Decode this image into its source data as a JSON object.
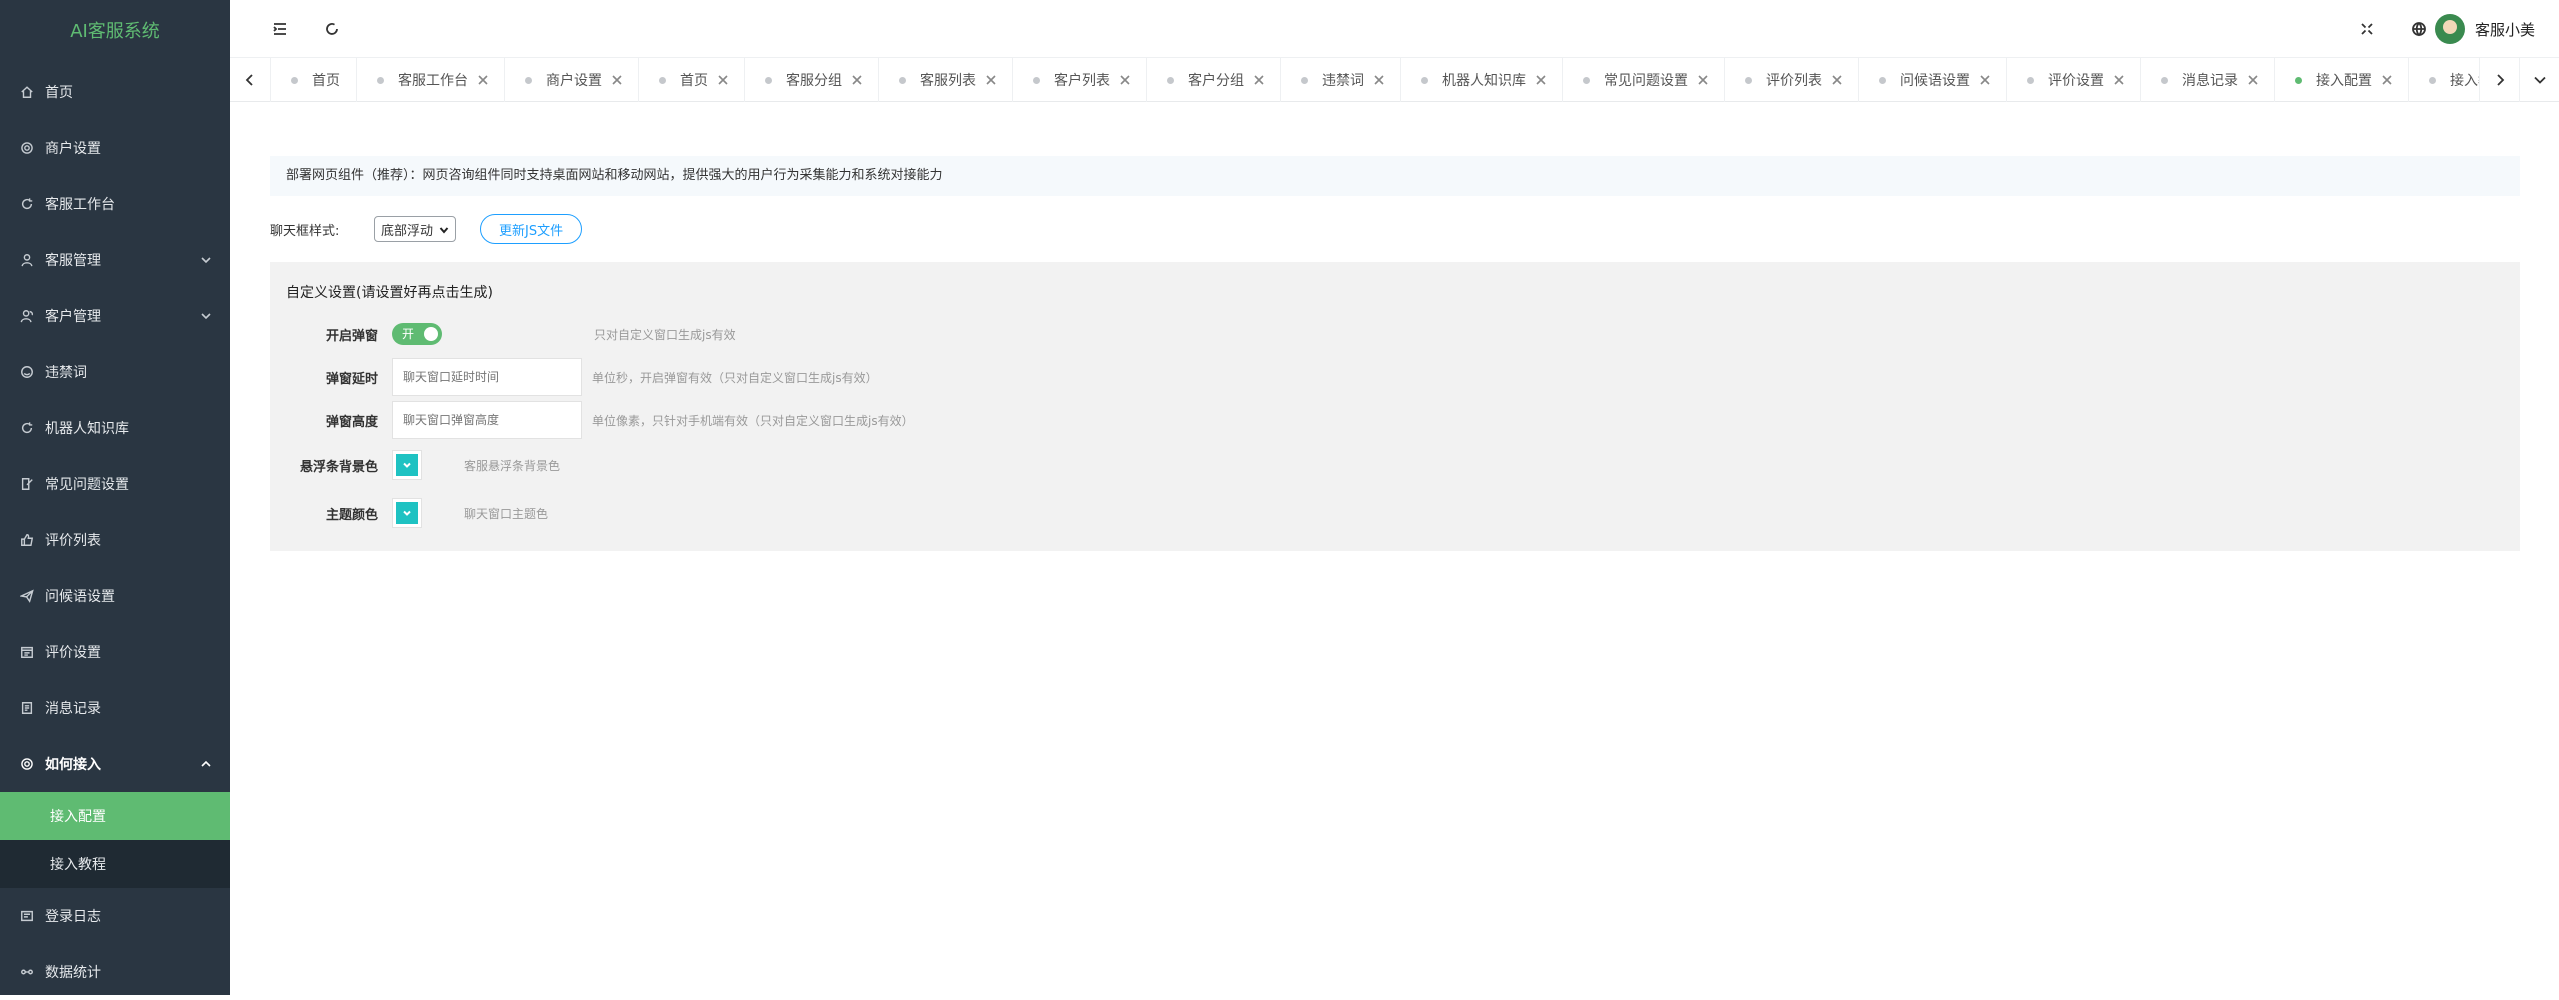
{
  "sidebar": {
    "logo": "AI客服系统",
    "items": [
      {
        "label": "首页",
        "icon": "home-icon"
      },
      {
        "label": "商户设置",
        "icon": "gear-icon"
      },
      {
        "label": "客服工作台",
        "icon": "refresh-icon"
      },
      {
        "label": "客服管理",
        "icon": "user-icon",
        "expandable": true
      },
      {
        "label": "客户管理",
        "icon": "users-icon",
        "expandable": true
      },
      {
        "label": "违禁词",
        "icon": "smile-icon"
      },
      {
        "label": "机器人知识库",
        "icon": "robot-icon"
      },
      {
        "label": "常见问题设置",
        "icon": "edit-icon"
      },
      {
        "label": "评价列表",
        "icon": "thumb-up-icon"
      },
      {
        "label": "问候语设置",
        "icon": "send-icon"
      },
      {
        "label": "评价设置",
        "icon": "calendar-icon"
      },
      {
        "label": "消息记录",
        "icon": "document-icon"
      },
      {
        "label": "如何接入",
        "icon": "gear-icon",
        "expanded": true
      },
      {
        "label": "接入配置"
      },
      {
        "label": "接入教程"
      },
      {
        "label": "登录日志",
        "icon": "list-icon"
      },
      {
        "label": "数据统计",
        "icon": "chart-icon"
      }
    ]
  },
  "header": {
    "user_name": "客服小美"
  },
  "tabs": [
    {
      "label": "首页",
      "closable": false,
      "active": false
    },
    {
      "label": "客服工作台",
      "closable": true,
      "active": false
    },
    {
      "label": "商户设置",
      "closable": true,
      "active": false
    },
    {
      "label": "首页",
      "closable": true,
      "active": false
    },
    {
      "label": "客服分组",
      "closable": true,
      "active": false
    },
    {
      "label": "客服列表",
      "closable": true,
      "active": false
    },
    {
      "label": "客户列表",
      "closable": true,
      "active": false
    },
    {
      "label": "客户分组",
      "closable": true,
      "active": false
    },
    {
      "label": "违禁词",
      "closable": true,
      "active": false
    },
    {
      "label": "机器人知识库",
      "closable": true,
      "active": false
    },
    {
      "label": "常见问题设置",
      "closable": true,
      "active": false
    },
    {
      "label": "评价列表",
      "closable": true,
      "active": false
    },
    {
      "label": "问候语设置",
      "closable": true,
      "active": false
    },
    {
      "label": "评价设置",
      "closable": true,
      "active": false
    },
    {
      "label": "消息记录",
      "closable": true,
      "active": false
    },
    {
      "label": "接入配置",
      "closable": true,
      "active": true
    },
    {
      "label": "接入教程",
      "closable": true,
      "active": false
    }
  ],
  "main": {
    "notice": "部署网页组件（推荐）：网页咨询组件同时支持桌面网站和移动网站，提供强大的用户行为采集能力和系统对接能力",
    "style_label": "聊天框样式:",
    "style_value": "底部浮动",
    "update_js_button": "更新JS文件",
    "panel_title": "自定义设置(请设置好再点击生成)",
    "fields": {
      "popup_toggle": {
        "label": "开启弹窗",
        "value": "开",
        "hint": "只对自定义窗口生成js有效"
      },
      "popup_delay": {
        "label": "弹窗延时",
        "placeholder": "聊天窗口延时时间",
        "hint": "单位秒，开启弹窗有效（只对自定义窗口生成js有效）"
      },
      "popup_height": {
        "label": "弹窗高度",
        "placeholder": "聊天窗口弹窗高度",
        "hint": "单位像素，只针对手机端有效（只对自定义窗口生成js有效）"
      },
      "float_bg_color": {
        "label": "悬浮条背景色",
        "hint": "客服悬浮条背景色",
        "color": "#1ec2c2"
      },
      "theme_color": {
        "label": "主题颜色",
        "hint": "聊天窗口主题色",
        "color": "#1ec2c2"
      }
    }
  },
  "colors": {
    "sidebar_bg": "#2a3642",
    "accent_green": "#5fbb72",
    "link_blue": "#1e9fff"
  }
}
